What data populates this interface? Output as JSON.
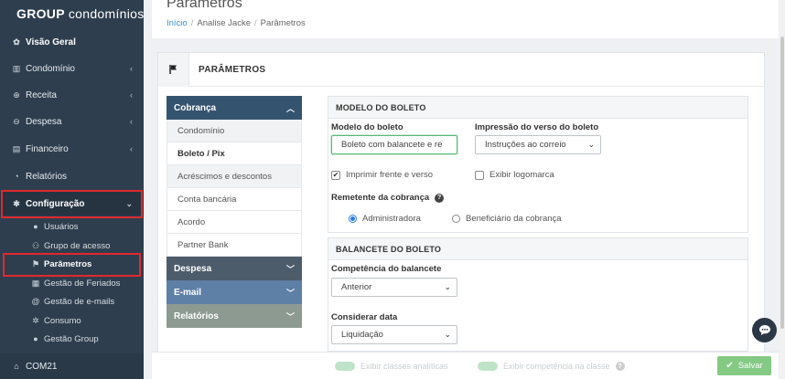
{
  "brand": {
    "bold": "GROUP",
    "rest": "condomínios"
  },
  "sidebar": {
    "items": [
      {
        "label": "Visão Geral",
        "icon": "users-icon",
        "glyph": "✿"
      },
      {
        "label": "Condomínio",
        "icon": "building-icon",
        "glyph": "▥"
      },
      {
        "label": "Receita",
        "icon": "plus-circle-icon",
        "glyph": "⊕"
      },
      {
        "label": "Despesa",
        "icon": "minus-circle-icon",
        "glyph": "⊖"
      },
      {
        "label": "Financeiro",
        "icon": "wallet-icon",
        "glyph": "▤"
      },
      {
        "label": "Relatórios",
        "icon": "pie-chart-icon",
        "glyph": "◔"
      },
      {
        "label": "Configuração",
        "icon": "gear-icon",
        "glyph": "✱"
      }
    ],
    "sub_items": [
      {
        "label": "Usuários",
        "icon": "user-icon",
        "glyph": "●"
      },
      {
        "label": "Grupo de acesso",
        "icon": "users-group-icon",
        "glyph": "⚇"
      },
      {
        "label": "Parâmetros",
        "icon": "flag-icon",
        "glyph": "⚑"
      },
      {
        "label": "Gestão de Feriados",
        "icon": "calendar-icon",
        "glyph": "▦"
      },
      {
        "label": "Gestão de e-mails",
        "icon": "at-icon",
        "glyph": "@"
      },
      {
        "label": "Consumo",
        "icon": "gears-icon",
        "glyph": "✲"
      },
      {
        "label": "Gestão Group",
        "icon": "user-icon",
        "glyph": "●"
      }
    ],
    "footer": {
      "label": "COM21",
      "icon": "home-icon",
      "glyph": "⌂"
    }
  },
  "header": {
    "title": "Parâmetros",
    "breadcrumb": [
      "Início",
      "Analise Jacke",
      "Parâmetros"
    ]
  },
  "panel": {
    "title": "PARÂMETROS"
  },
  "menu": {
    "sections": [
      "Cobrança",
      "Despesa",
      "E-mail",
      "Relatórios"
    ],
    "cobranca_items": [
      "Condomínio",
      "Boleto / Pix",
      "Acréscimos e descontos",
      "Conta bancária",
      "Acordo",
      "Partner Bank"
    ]
  },
  "modelo": {
    "title": "MODELO DO BOLETO",
    "modelo_label": "Modelo do boleto",
    "modelo_value": "Boleto com balancete e re",
    "verso_label": "Impressão do verso do boleto",
    "verso_value": "Instruções ao correio",
    "check_frente": "Imprimir frente e verso",
    "check_logo": "Exibir logomarca",
    "remetente_label": "Remetente da cobrança",
    "radio_admin": "Administradora",
    "radio_benef": "Beneficiário da cobrança"
  },
  "balancete": {
    "title": "BALANCETE DO BOLETO",
    "competencia_label": "Competência do balancete",
    "competencia_value": "Anterior",
    "considerar_label": "Considerar data",
    "considerar_value": "Liquidação"
  },
  "footer": {
    "toggle1": "Exibir classes analíticas",
    "toggle2": "Exibir competência na classe",
    "save": "Salvar"
  },
  "colors": {
    "sidebar": "#2e3e4e",
    "accent": "#5cb85c",
    "highlight": "#e0282d",
    "section": "#34536f"
  }
}
